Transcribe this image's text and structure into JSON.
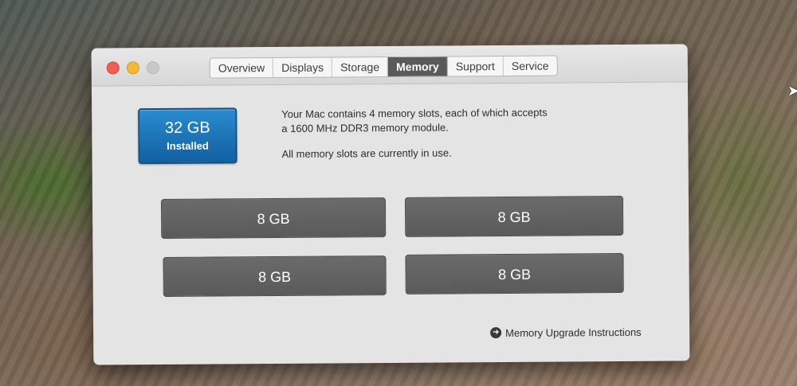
{
  "window": {
    "tabs": [
      {
        "label": "Overview"
      },
      {
        "label": "Displays"
      },
      {
        "label": "Storage"
      },
      {
        "label": "Memory",
        "active": true
      },
      {
        "label": "Support"
      },
      {
        "label": "Service"
      }
    ]
  },
  "memory": {
    "installed_size": "32 GB",
    "installed_label": "Installed",
    "description_line1": "Your Mac contains 4 memory slots, each of which accepts",
    "description_line2": "a 1600 MHz DDR3 memory module.",
    "description_status": "All memory slots are currently in use.",
    "slots": [
      {
        "label": "8 GB"
      },
      {
        "label": "8 GB"
      },
      {
        "label": "8 GB"
      },
      {
        "label": "8 GB"
      }
    ],
    "upgrade_link": "Memory Upgrade Instructions"
  },
  "icons": {
    "close": "close-icon",
    "minimize": "minimize-icon",
    "zoom": "zoom-icon",
    "upgrade_arrow": "arrow-right-circle-icon",
    "cursor": "mouse-cursor-icon"
  },
  "colors": {
    "installed_badge": "#1e75b8",
    "slot": "#5f5f5f",
    "active_tab": "#5a5a5a",
    "close": "#ee5f57",
    "minimize": "#f4b83a"
  }
}
